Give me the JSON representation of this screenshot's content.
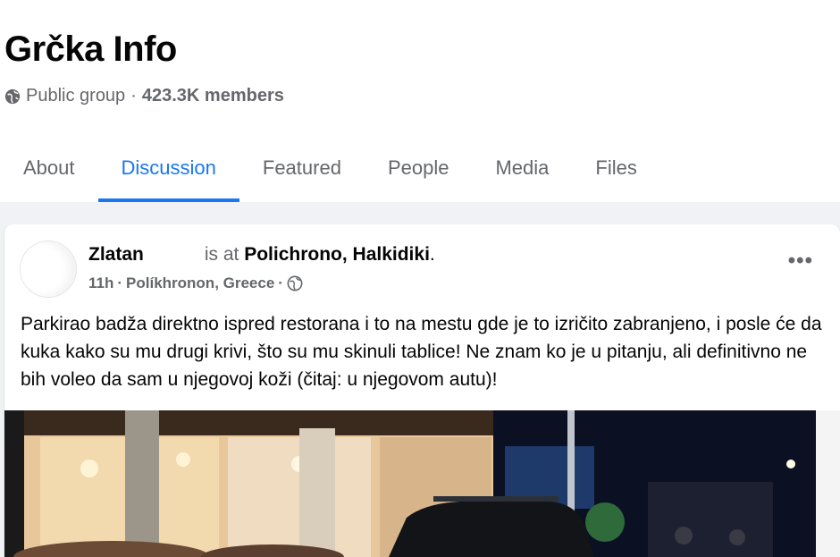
{
  "group": {
    "name": "Grčka Info",
    "privacy": "Public group",
    "separator": "·",
    "members": "423.3K members"
  },
  "tabs": [
    {
      "label": "About",
      "active": false
    },
    {
      "label": "Discussion",
      "active": true
    },
    {
      "label": "Featured",
      "active": false
    },
    {
      "label": "People",
      "active": false
    },
    {
      "label": "Media",
      "active": false
    },
    {
      "label": "Files",
      "active": false
    }
  ],
  "post": {
    "author": "Zlatan",
    "is_at": "is at",
    "place": "Polichrono, Halkidiki",
    "period": ".",
    "time": "11h",
    "location": "Políkhronon, Greece",
    "sep": "·",
    "more": "•••",
    "text": "Parkirao badža direktno ispred restorana i to na mestu gde je to izričito zabranjeno, i posle će da kuka kako su mu drugi krivi, što su mu skinuli tablice! Ne znam ko je u pitanju, ali definitivno ne bih voleo da sam u njegovoj koži (čitaj: u njegovom autu)!"
  },
  "colors": {
    "accent": "#1877f2",
    "secondary_text": "#65676b",
    "background": "#f0f2f5"
  },
  "icons": {
    "privacy": "globe-icon",
    "audience": "globe-icon",
    "menu": "more-options-icon"
  }
}
